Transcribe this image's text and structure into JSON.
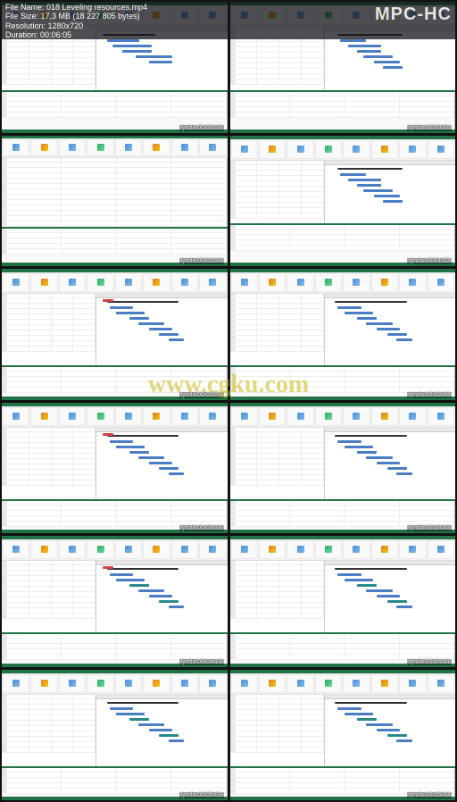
{
  "player": {
    "app": "MPC-HC",
    "file_name_label": "File Name:",
    "file_name": "018 Leveling resources.mp4",
    "file_size_label": "File Size:",
    "file_size": "17,3 MB (18 227 805 bytes)",
    "resolution_label": "Resolution:",
    "resolution": "1280x720",
    "duration_label": "Duration:",
    "duration": "00:06:05"
  },
  "watermark": "www.cgku.com",
  "watermark_brand": "lynda",
  "thumbs": [
    {
      "time": "00:00:28",
      "style": "table"
    },
    {
      "time": "00:00:56",
      "style": "gantt"
    },
    {
      "time": "00:01:24",
      "style": "sheet"
    },
    {
      "time": "00:01:52",
      "style": "gantt"
    },
    {
      "time": "00:02:20",
      "style": "gantt_split"
    },
    {
      "time": "00:02:48",
      "style": "gantt_split"
    },
    {
      "time": "00:03:16",
      "style": "gantt_split"
    },
    {
      "time": "00:03:45",
      "style": "gantt_split"
    },
    {
      "time": "00:04:13",
      "style": "gantt_split"
    },
    {
      "time": "00:04:41",
      "style": "gantt_split"
    },
    {
      "time": "00:05:09",
      "style": "gantt_split"
    },
    {
      "time": "00:05:37",
      "style": "gantt_split"
    }
  ]
}
